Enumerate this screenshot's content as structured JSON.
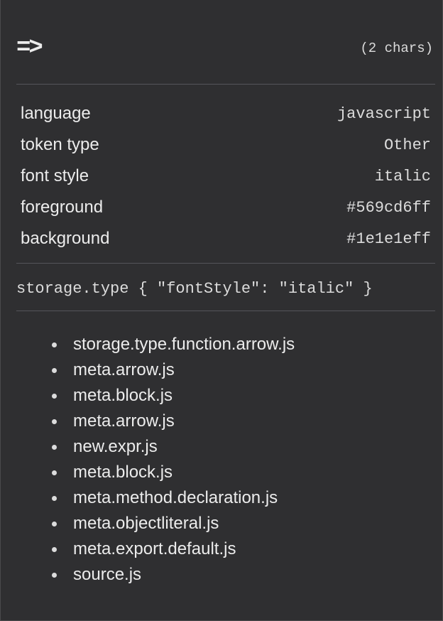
{
  "token": {
    "text": "=>",
    "char_count": "(2 chars)"
  },
  "properties": [
    {
      "label": "language",
      "value": "javascript"
    },
    {
      "label": "token type",
      "value": "Other"
    },
    {
      "label": "font style",
      "value": "italic"
    },
    {
      "label": "foreground",
      "value": "#569cd6ff"
    },
    {
      "label": "background",
      "value": "#1e1e1eff"
    }
  ],
  "theme_rule": "storage.type { \"fontStyle\": \"italic\" }",
  "scopes": [
    "storage.type.function.arrow.js",
    "meta.arrow.js",
    "meta.block.js",
    "meta.arrow.js",
    "new.expr.js",
    "meta.block.js",
    "meta.method.declaration.js",
    "meta.objectliteral.js",
    "meta.export.default.js",
    "source.js"
  ]
}
